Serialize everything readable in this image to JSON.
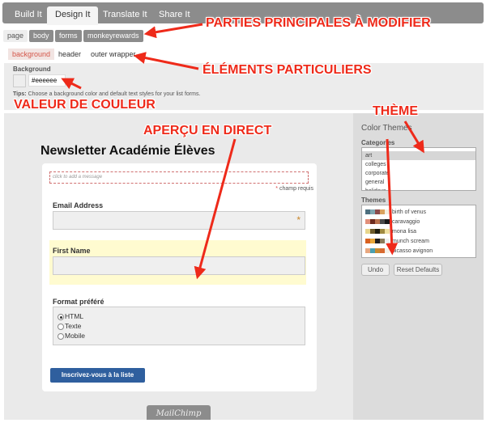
{
  "tabs": [
    {
      "label": "Build It"
    },
    {
      "label": "Design It"
    },
    {
      "label": "Translate It"
    },
    {
      "label": "Share It"
    }
  ],
  "subtabs": [
    {
      "label": "page"
    },
    {
      "label": "body"
    },
    {
      "label": "forms"
    },
    {
      "label": "monkeyrewards"
    }
  ],
  "elements": [
    {
      "label": "background"
    },
    {
      "label": "header"
    },
    {
      "label": "outer wrapper"
    }
  ],
  "editor": {
    "label": "Background",
    "value": "#eeeeee",
    "tips_bold": "Tips:",
    "tips": "Choose a background color and default text styles for your list forms."
  },
  "form": {
    "title": "Newsletter Académie Élèves",
    "message_placeholder": "click to add a message",
    "required_note": "champ requis",
    "email_label": "Email Address",
    "first_name_label": "First Name",
    "format_label": "Format préféré",
    "formats": [
      "HTML",
      "Texte",
      "Mobile"
    ],
    "selected_format": "HTML",
    "submit": "Inscrivez-vous à la liste",
    "badge": "MailChimp"
  },
  "sidebar": {
    "title": "Color Themes",
    "categories_label": "Categories",
    "categories": [
      "art",
      "colleges",
      "corporate",
      "general",
      "holidays"
    ],
    "selected_category": "art",
    "themes_label": "Themes",
    "themes": [
      {
        "name": "birth of venus",
        "colors": [
          "#4d6f7e",
          "#7fa7b1",
          "#8c4c4c",
          "#d9a25e",
          "#f5efe0"
        ]
      },
      {
        "name": "caravaggio",
        "colors": [
          "#e2907a",
          "#6b2a1e",
          "#b9714e",
          "#4a4a4a",
          "#1a1a1a"
        ]
      },
      {
        "name": "mona lisa",
        "colors": [
          "#e8d68c",
          "#6b5a2a",
          "#1e1e10",
          "#a08a40",
          "#f0e0a0"
        ]
      },
      {
        "name": "munch scream",
        "colors": [
          "#d9611f",
          "#e8a83a",
          "#202020",
          "#8a7a5a",
          "#f0f0f0"
        ]
      },
      {
        "name": "picasso avignon",
        "colors": [
          "#e8a880",
          "#4aa0b0",
          "#c88a30",
          "#d86a30",
          "#f4f0e8"
        ]
      }
    ],
    "undo": "Undo",
    "reset": "Reset Defaults"
  },
  "annotations": {
    "main_parts": "PARTIES PRINCIPALES À MODIFIER",
    "elements": "ÉLÉMENTS PARTICULIERS",
    "color_value": "VALEUR DE COULEUR",
    "preview": "APERÇU EN DIRECT",
    "theme": "THÈME"
  },
  "colors": {
    "annotation": "#ee2a1a",
    "tab_bar": "#8c8c8c",
    "submit": "#2f5f9e",
    "highlight": "#fffbd0"
  }
}
